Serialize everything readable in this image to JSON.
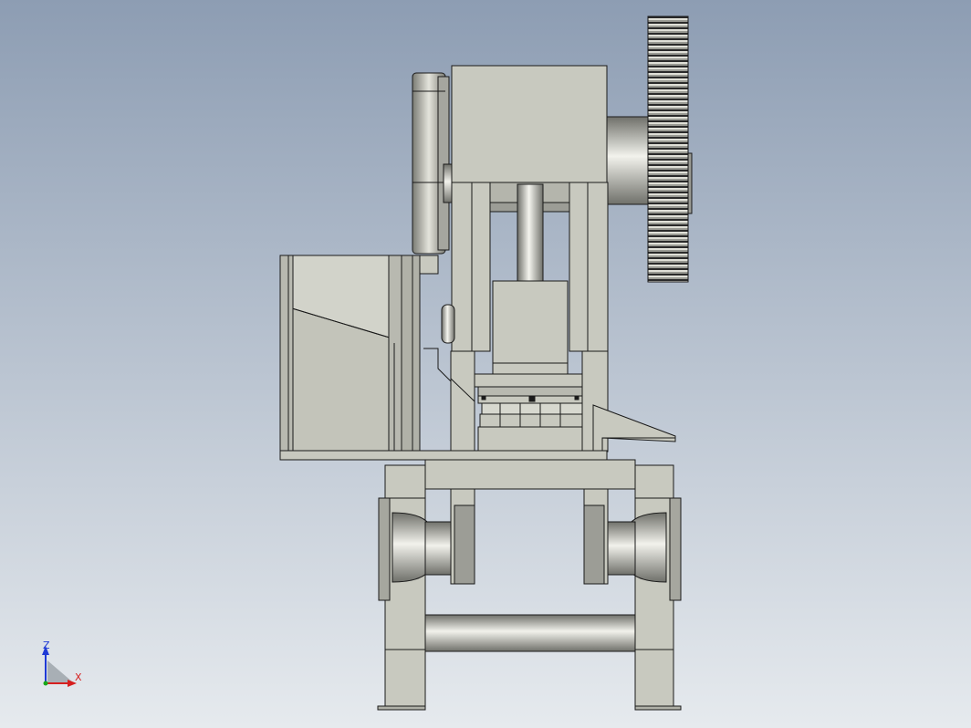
{
  "viewport": {
    "background_top": "#8d9db3",
    "background_bottom": "#e6eaee",
    "body_color": "#c8c9bf",
    "edge_color": "#1a1a1a",
    "shade_color": "#8a8a84"
  },
  "triad": {
    "z_label": "Z",
    "x_label": "X",
    "z_color": "#1f3ad6",
    "x_color": "#d61f1f",
    "y_color": "#18a818"
  }
}
